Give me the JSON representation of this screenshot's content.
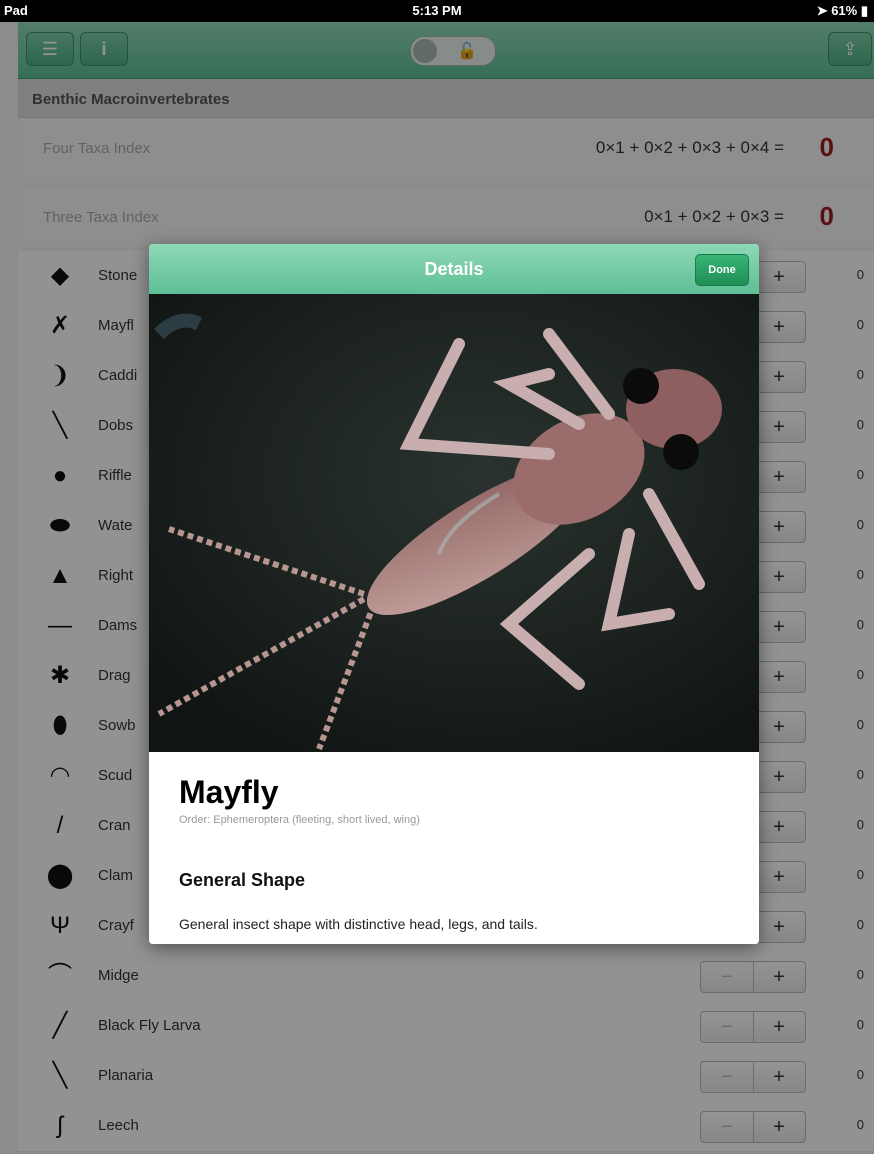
{
  "status": {
    "carrier": "Pad",
    "time": "5:13 PM",
    "battery": "61%"
  },
  "toolbar": {
    "menu_icon": "menu-icon",
    "info_icon": "info-icon",
    "share_icon": "share-icon",
    "lock_icon": "unlock-icon"
  },
  "section": {
    "title": "Benthic Macroinvertebrates"
  },
  "indices": [
    {
      "label": "Four Taxa Index",
      "formula": "0×1 + 0×2 + 0×3 + 0×4 =",
      "result": "0"
    },
    {
      "label": "Three Taxa Index",
      "formula": "0×1 + 0×2 + 0×3 =",
      "result": "0"
    }
  ],
  "stepper": {
    "minus": "−",
    "plus": "+"
  },
  "taxa": [
    {
      "name": "Stone",
      "icon": "◆",
      "count": "0"
    },
    {
      "name": "Mayfl",
      "icon": "✗",
      "count": "0"
    },
    {
      "name": "Caddi",
      "icon": "❩",
      "count": "0"
    },
    {
      "name": "Dobs",
      "icon": "╲",
      "count": "0"
    },
    {
      "name": "Riffle",
      "icon": "●",
      "count": "0"
    },
    {
      "name": "Wate",
      "icon": "⬬",
      "count": "0"
    },
    {
      "name": "Right",
      "icon": "▲",
      "count": "0"
    },
    {
      "name": "Dams",
      "icon": "—",
      "count": "0"
    },
    {
      "name": "Drag",
      "icon": "✱",
      "count": "0"
    },
    {
      "name": "Sowb",
      "icon": "⬮",
      "count": "0"
    },
    {
      "name": "Scud",
      "icon": "◠",
      "count": "0"
    },
    {
      "name": "Cran",
      "icon": "/",
      "count": "0"
    },
    {
      "name": "Clam",
      "icon": "⬤",
      "count": "0"
    },
    {
      "name": "Crayf",
      "icon": "Ψ",
      "count": "0"
    },
    {
      "name": "Midge",
      "icon": "⌒",
      "count": "0"
    },
    {
      "name": "Black Fly Larva",
      "icon": "╱",
      "count": "0"
    },
    {
      "name": "Planaria",
      "icon": "╲",
      "count": "0"
    },
    {
      "name": "Leech",
      "icon": "ʃ",
      "count": "0"
    }
  ],
  "modal": {
    "title": "Details",
    "done_label": "Done",
    "species": "Mayfly",
    "order": "Order: Ephemeroptera (fleeting, short lived, wing)",
    "subheading": "General Shape",
    "description": "General insect shape with distinctive head, legs, and tails."
  },
  "colors": {
    "accent": "#6cc9a1",
    "result": "#9b1d1d",
    "done": "#2aa566"
  }
}
